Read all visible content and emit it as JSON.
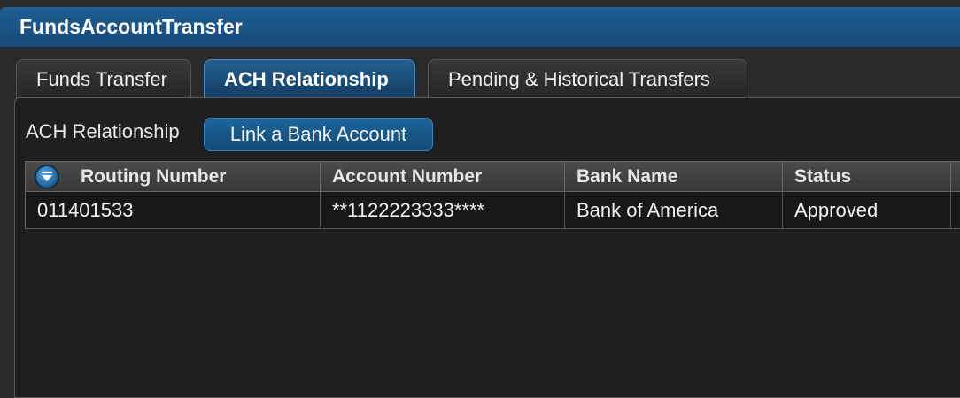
{
  "window": {
    "title": "FundsAccountTransfer"
  },
  "tabs": [
    {
      "label": "Funds Transfer",
      "active": false
    },
    {
      "label": "ACH Relationship",
      "active": true
    },
    {
      "label": "Pending & Historical Transfers",
      "active": false
    }
  ],
  "toolbar": {
    "label": "ACH Relationship",
    "link_button": "Link a Bank Account"
  },
  "table": {
    "columns": [
      "Routing Number",
      "Account Number",
      "Bank Name",
      "Status"
    ],
    "rows": [
      {
        "routing": "011401533",
        "account": "**1122223333****",
        "bank": "Bank of America",
        "status": "Approved"
      }
    ]
  },
  "colors": {
    "accent": "#1f5e93",
    "background": "#1f1f1f"
  }
}
